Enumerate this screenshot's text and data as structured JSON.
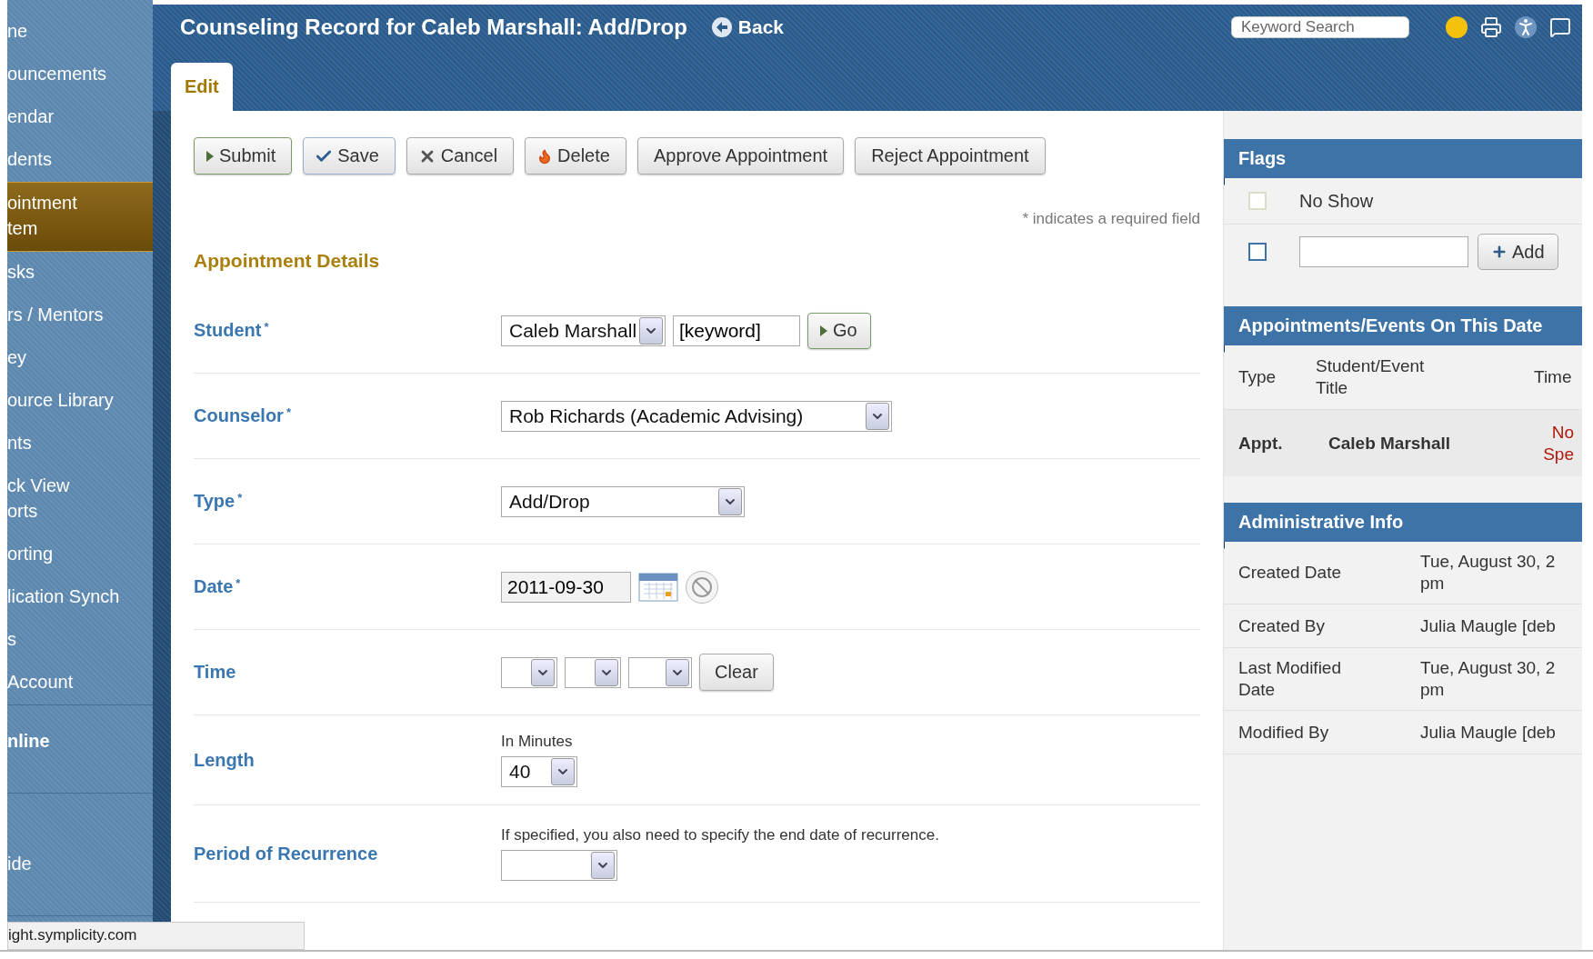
{
  "sidebar": {
    "items": [
      {
        "label": "ne",
        "selected": false
      },
      {
        "label": "ouncements",
        "selected": false
      },
      {
        "label": "endar",
        "selected": false
      },
      {
        "label": "dents",
        "selected": false
      },
      {
        "label": "ointment\ntem",
        "selected": true
      },
      {
        "label": "sks",
        "selected": false
      },
      {
        "label": "rs / Mentors",
        "selected": false
      },
      {
        "label": "ey",
        "selected": false
      },
      {
        "label": "ource Library",
        "selected": false
      },
      {
        "label": "nts",
        "selected": false
      },
      {
        "label": "ck View\norts",
        "selected": false
      },
      {
        "label": "orting",
        "selected": false
      },
      {
        "label": "lication Synch",
        "selected": false
      },
      {
        "label": "s",
        "selected": false
      },
      {
        "label": "Account",
        "selected": false
      }
    ],
    "sections": [
      {
        "label": "nline"
      },
      {
        "label": "ide"
      }
    ]
  },
  "header": {
    "title": "Counseling Record for Caleb Marshall: Add/Drop",
    "back": "Back",
    "search": {
      "placeholder": "Keyword Search"
    }
  },
  "tabs": [
    {
      "label": "Edit",
      "selected": true
    }
  ],
  "toolbar": {
    "buttons": [
      {
        "label": "Submit",
        "kind": "submit"
      },
      {
        "label": "Save",
        "kind": "save"
      },
      {
        "label": "Cancel",
        "kind": "cancel"
      },
      {
        "label": "Delete",
        "kind": "delete"
      },
      {
        "label": "Approve Appointment",
        "kind": "plain"
      },
      {
        "label": "Reject Appointment",
        "kind": "plain"
      }
    ]
  },
  "required_note": "* indicates a required field",
  "section_title": "Appointment Details",
  "fields": [
    {
      "kind": "student",
      "label": "Student",
      "mark": "*",
      "value": "Caleb Marshall",
      "keyword": "[keyword]",
      "go": "Go"
    },
    {
      "kind": "select",
      "label": "Counselor",
      "mark": "*",
      "value": "Rob Richards (Academic Advising)"
    },
    {
      "kind": "select",
      "label": "Type",
      "mark": "*",
      "value": "Add/Drop"
    },
    {
      "kind": "date",
      "label": "Date",
      "mark": "*",
      "value": "2011-09-30"
    },
    {
      "kind": "time",
      "label": "Time",
      "clear": "Clear"
    },
    {
      "kind": "length",
      "label": "Length",
      "hint": "In Minutes",
      "value": "40"
    },
    {
      "kind": "recurrence",
      "label": "Period of Recurrence",
      "hint": "If specified, you also need to specify the end date of recurrence."
    }
  ],
  "flags": {
    "title": "Flags",
    "items": [
      {
        "label": "No Show",
        "checked": false
      }
    ],
    "new_flag": {
      "checked": false,
      "add": "Add"
    }
  },
  "appointments": {
    "title": "Appointments/Events On This Date",
    "columns": [
      "Type",
      "Student/Event\nTitle",
      "Time"
    ],
    "rows": [
      {
        "type": "Appt.",
        "title": "Caleb Marshall",
        "time": "No\nSpe"
      }
    ]
  },
  "admin": {
    "title": "Administrative Info",
    "rows": [
      {
        "label": "Created Date",
        "value": "Tue, August 30, 2\npm"
      },
      {
        "label": "Created By",
        "value": "Julia Maugle [deb"
      },
      {
        "label": "Last Modified\nDate",
        "value": "Tue, August 30, 2\npm"
      },
      {
        "label": "Modified By",
        "value": "Julia Maugle [deb"
      }
    ]
  },
  "status_bar": {
    "url": "ight.symplicity.com"
  }
}
